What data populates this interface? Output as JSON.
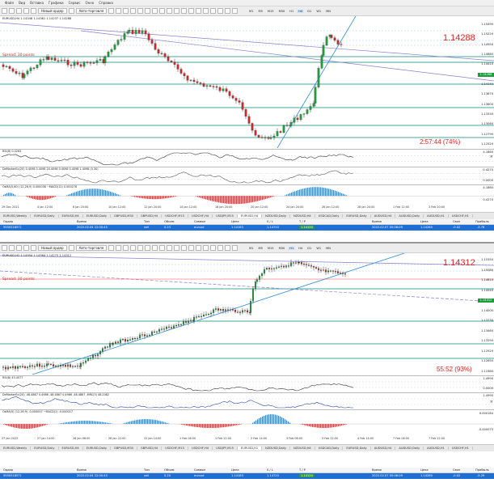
{
  "menu": {
    "items": [
      "Файл",
      "Вид",
      "Вставка",
      "Графики",
      "Сервис",
      "Окно",
      "Справка"
    ]
  },
  "toolbar": {
    "new_order": "Новый ордер",
    "auto_trading": "Авто-торговля",
    "timeframes": [
      "M1",
      "M5",
      "M15",
      "M30",
      "H1",
      "H4",
      "D1",
      "W1",
      "MN"
    ]
  },
  "top": {
    "info_line": "EURUSD,H4  1.14348 1.14361 1.14237 1.14288",
    "current_price": "1.14288",
    "spread": "Spread: 30 points",
    "timer": "2:57:44 (74%)",
    "price_labels": [
      "1.15490",
      "1.15220",
      "1.14950",
      "1.14680",
      "1.14410",
      "1.14288",
      "1.14140",
      "1.13870",
      "1.13600",
      "1.13330",
      "1.13060",
      "1.12790",
      "1.12520"
    ],
    "indicators": {
      "rsi": "RSI(8) 0.0263",
      "osc": "DeMarkerEx(20) 0.4098 0.4098 24.4098 0.4098 0.4098 1.4098 (0.30)",
      "macd": "OsMA(5,60) (12,26,9) 0.000038 ~MACD(12) 0.000278"
    },
    "indicator_scale": [
      "4.1860",
      "0.4270",
      "0.0000",
      "4.1860",
      "0.4270"
    ],
    "xaxis": [
      "29 Dec 2021",
      "4 Jan 12:00",
      "6 Jan 20:00",
      "10 Jan 12:00",
      "12 Jan 20:00",
      "14 Jan 12:00",
      "18 Jan 20:00",
      "20 Jan 12:00",
      "24 Jan 20:00",
      "26 Jan 12:00",
      "28 Jan 20:00",
      "1 Feb 12:00",
      "3 Feb 20:00"
    ],
    "tabs": [
      "EURUSD,Weekly",
      "EURUSD,Daily",
      "EURUSD,H4",
      "EURUSD,Daily",
      "GBPUSD,M30",
      "GBPUSD,H4",
      "USDCHF,M15",
      "USDCHF,H4",
      "USDJPY,M15",
      "EURUSD,H4",
      "NZDUSD,Daily",
      "NZDUSD,H4",
      "USDCAD,Daily",
      "EURUSD,Daily",
      "AUDUSD,H4",
      "AUDUSD,Daily",
      "AUDUSD,H1",
      "USDCHF,H1"
    ],
    "active_tab": 9
  },
  "bottom": {
    "info_line": "EURUSD,H1  1.14354 1.14364 1.14275 1.14312",
    "current_price": "1.14312",
    "spread": "Spread: 30 points",
    "timer": "55:52 (93%)",
    "price_labels": [
      "1.15350",
      "1.15080",
      "1.14810",
      "1.14540",
      "1.14312",
      "1.14000",
      "1.13730",
      "1.13460",
      "1.13190",
      "1.12920",
      "1.12650",
      "1.12380"
    ],
    "indicators": {
      "rsi": "RSI(8) 43.4577",
      "osc": "DeMarkerEx(20) -48.4867 0.4986 -48.4867 0.4986 -48.4867 -MRC(5) 48.2082",
      "macd": "OsMA(5) (12,26,9) -0.000057 ~MACD(1) -0.000027"
    },
    "indicator_scale": [
      "1.4990",
      "0.0000",
      "1.4990",
      "0.000184",
      "-0.000075"
    ],
    "xaxis": [
      "27 Jan 2022",
      "27 Jan 14:00",
      "28 Jan 06:00",
      "28 Jan 22:00",
      "31 Jan 14:00",
      "1 Feb 06:00",
      "1 Feb 22:00",
      "2 Feb 14:00",
      "3 Feb 06:00",
      "3 Feb 22:00",
      "4 Feb 14:00",
      "7 Feb 06:00",
      "7 Feb 22:00"
    ],
    "tabs": [
      "EURUSD,Weekly",
      "EURUSD,Daily",
      "EURUSD,H4",
      "EURUSD,Daily",
      "GBPUSD,M30",
      "GBPUSD,H4",
      "USDCHF,M15",
      "USDCHF,H4",
      "USDJPY,M15",
      "EURUSD,H1",
      "NZDUSD,Daily",
      "NZDUSD,H4",
      "USDCAD,Daily",
      "EURUSD,Daily",
      "AUDUSD,H4",
      "AUDUSD,Daily",
      "AUDUSD,H1",
      "USDCHF,H1"
    ],
    "active_tab": 9
  },
  "orders": {
    "headers": [
      "Ордер",
      "Время",
      "Тип",
      "Объем",
      "Символ",
      "Цена",
      "S / L",
      "T / P",
      "Время",
      "Цена",
      "Своп",
      "Прибыль"
    ],
    "top_row": [
      "5950518571",
      "2022.02.04 22:00:45",
      "sell",
      "0.23",
      "eurusd",
      "1.14183",
      "1.14720",
      "1.14120",
      "",
      "2022.02.07 05:06:09",
      "1.14285",
      "-0.02",
      "-3.76"
    ],
    "bottom_row": [
      "5950518571",
      "2022.02.04 22:00:45",
      "sell",
      "0.20",
      "eurusd",
      "1.14183",
      "1.14720",
      "1.14120",
      "",
      "2022.02.07 05:06:09",
      "1.14260",
      "-0.02",
      "-5.29"
    ]
  },
  "colors": {
    "bull": "#1a9e3a",
    "bear": "#e02020",
    "trend": "#2b8be0",
    "channel": "#8a7fd0",
    "level": "#0e8a7a"
  }
}
